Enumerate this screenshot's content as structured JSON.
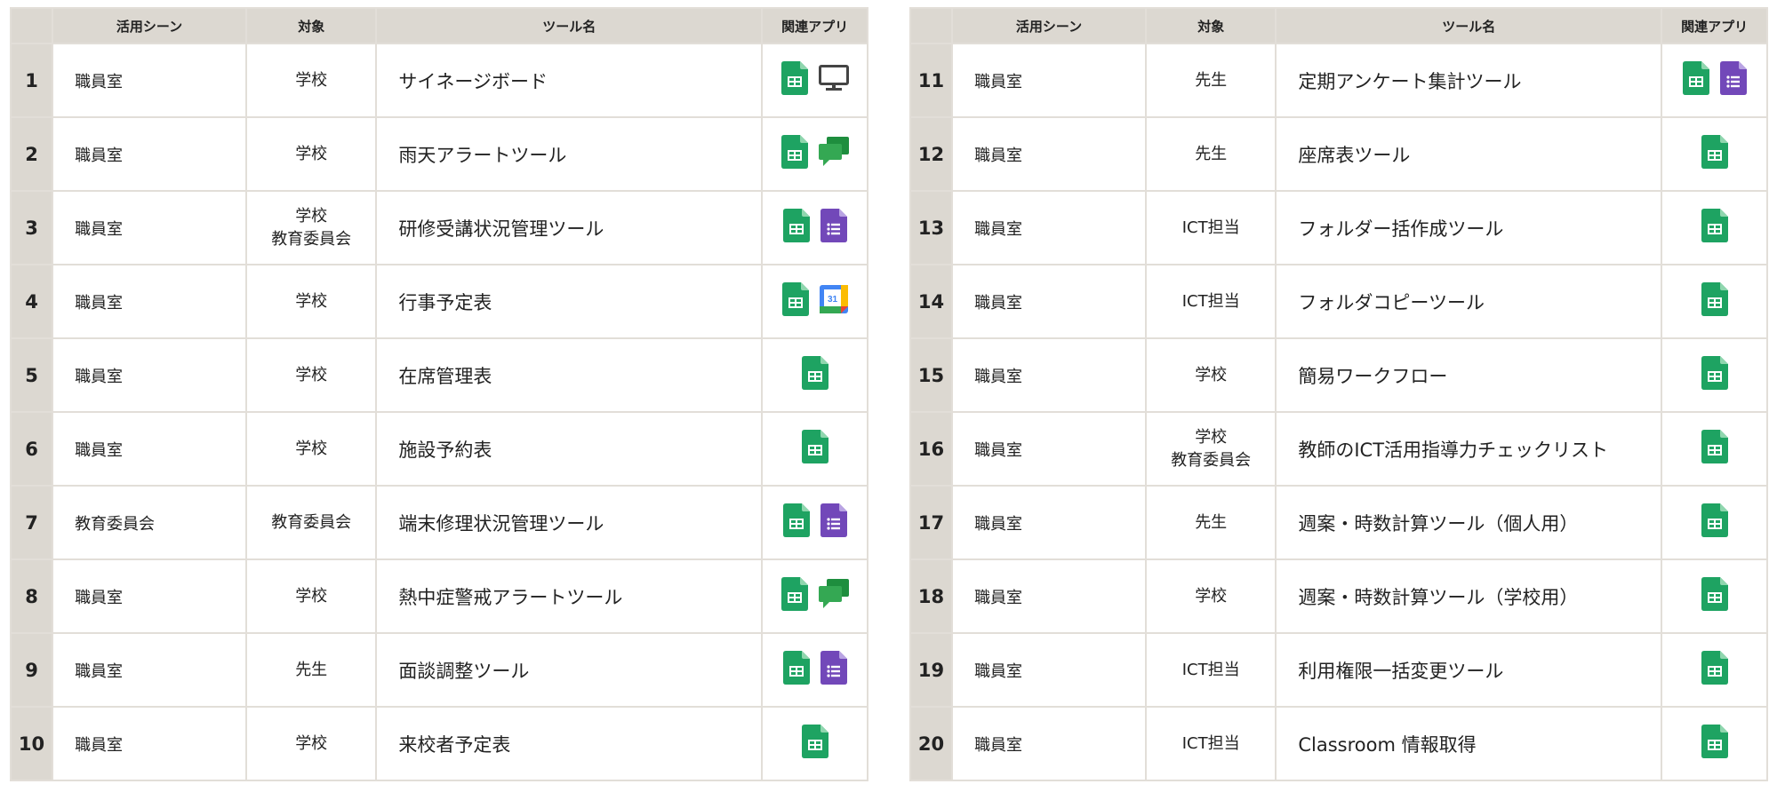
{
  "headers": {
    "scene": "活用シーン",
    "target": "対象",
    "tool": "ツール名",
    "apps": "関連アプリ"
  },
  "left_rows": [
    {
      "num": "1",
      "scene": "職員室",
      "target": [
        "学校"
      ],
      "tool": "サイネージボード",
      "apps": [
        "sheets-icon",
        "monitor-icon"
      ]
    },
    {
      "num": "2",
      "scene": "職員室",
      "target": [
        "学校"
      ],
      "tool": "雨天アラートツール",
      "apps": [
        "sheets-icon",
        "chat-icon"
      ]
    },
    {
      "num": "3",
      "scene": "職員室",
      "target": [
        "学校",
        "教育委員会"
      ],
      "tool": "研修受講状況管理ツール",
      "apps": [
        "sheets-icon",
        "forms-icon"
      ]
    },
    {
      "num": "4",
      "scene": "職員室",
      "target": [
        "学校"
      ],
      "tool": "行事予定表",
      "apps": [
        "sheets-icon",
        "calendar-icon"
      ]
    },
    {
      "num": "5",
      "scene": "職員室",
      "target": [
        "学校"
      ],
      "tool": "在席管理表",
      "apps": [
        "sheets-icon"
      ]
    },
    {
      "num": "6",
      "scene": "職員室",
      "target": [
        "学校"
      ],
      "tool": "施設予約表",
      "apps": [
        "sheets-icon"
      ]
    },
    {
      "num": "7",
      "scene": "教育委員会",
      "target": [
        "教育委員会"
      ],
      "tool": "端末修理状況管理ツール",
      "apps": [
        "sheets-icon",
        "forms-icon"
      ]
    },
    {
      "num": "8",
      "scene": "職員室",
      "target": [
        "学校"
      ],
      "tool": "熱中症警戒アラートツール",
      "apps": [
        "sheets-icon",
        "chat-icon"
      ]
    },
    {
      "num": "9",
      "scene": "職員室",
      "target": [
        "先生"
      ],
      "tool": "面談調整ツール",
      "apps": [
        "sheets-icon",
        "forms-icon"
      ]
    },
    {
      "num": "10",
      "scene": "職員室",
      "target": [
        "学校"
      ],
      "tool": "来校者予定表",
      "apps": [
        "sheets-icon"
      ]
    }
  ],
  "right_rows": [
    {
      "num": "11",
      "scene": "職員室",
      "target": [
        "先生"
      ],
      "tool": "定期アンケート集計ツール",
      "apps": [
        "sheets-icon",
        "forms-icon"
      ]
    },
    {
      "num": "12",
      "scene": "職員室",
      "target": [
        "先生"
      ],
      "tool": "座席表ツール",
      "apps": [
        "sheets-icon"
      ]
    },
    {
      "num": "13",
      "scene": "職員室",
      "target": [
        "ICT担当"
      ],
      "tool": "フォルダー括作成ツール",
      "apps": [
        "sheets-icon"
      ]
    },
    {
      "num": "14",
      "scene": "職員室",
      "target": [
        "ICT担当"
      ],
      "tool": "フォルダコピーツール",
      "apps": [
        "sheets-icon"
      ]
    },
    {
      "num": "15",
      "scene": "職員室",
      "target": [
        "学校"
      ],
      "tool": "簡易ワークフロー",
      "apps": [
        "sheets-icon"
      ]
    },
    {
      "num": "16",
      "scene": "職員室",
      "target": [
        "学校",
        "教育委員会"
      ],
      "tool": "教師のICT活用指導力チェックリスト",
      "apps": [
        "sheets-icon"
      ]
    },
    {
      "num": "17",
      "scene": "職員室",
      "target": [
        "先生"
      ],
      "tool": "週案・時数計算ツール（個人用）",
      "apps": [
        "sheets-icon"
      ]
    },
    {
      "num": "18",
      "scene": "職員室",
      "target": [
        "学校"
      ],
      "tool": "週案・時数計算ツール（学校用）",
      "apps": [
        "sheets-icon"
      ]
    },
    {
      "num": "19",
      "scene": "職員室",
      "target": [
        "ICT担当"
      ],
      "tool": "利用権限一括変更ツール",
      "apps": [
        "sheets-icon"
      ]
    },
    {
      "num": "20",
      "scene": "職員室",
      "target": [
        "ICT担当"
      ],
      "tool": "Classroom 情報取得",
      "apps": [
        "sheets-icon"
      ]
    }
  ],
  "calendar_icon_text": "31",
  "colors": {
    "header_bg": "#dcd8d1",
    "border": "#e2ded8",
    "sheets_green": "#1ea362",
    "forms_purple": "#7248b9",
    "chat_green": "#34a853",
    "monitor_gray": "#444444"
  }
}
